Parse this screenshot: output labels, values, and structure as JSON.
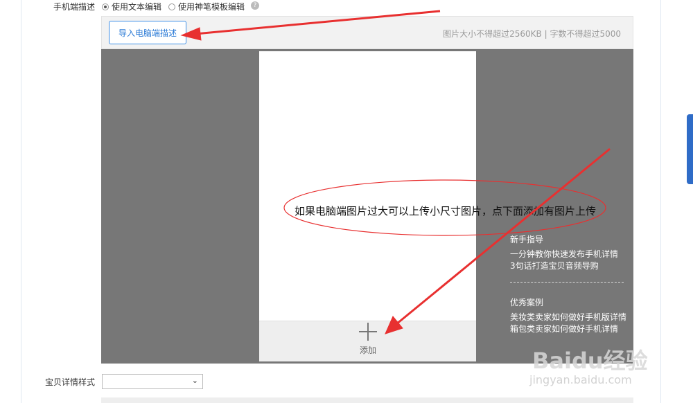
{
  "form": {
    "mobile_desc_label": "手机端描述",
    "radio_text_edit": "使用文本编辑",
    "radio_template_edit": "使用神笔模板编辑",
    "help_icon": "?"
  },
  "toolbar": {
    "import_button": "导入电脑端描述",
    "limit_text": "图片大小不得超过2560KB | 字数不得超过5000"
  },
  "editor": {
    "add_label": "添加",
    "annotation": "如果电脑端图片过大可以上传小尺寸图片，点下面添加有图片上传"
  },
  "guide": {
    "newbie_title": "新手指导",
    "newbie_links": [
      "一分钟教你快速发布手机详情",
      "3句话打造宝贝音频导购"
    ],
    "cases_title": "优秀案例",
    "cases_links": [
      "美妆类卖家如何做好手机版详情",
      "箱包类卖家如何做好手机详情"
    ]
  },
  "detail": {
    "style_label": "宝贝详情样式",
    "style_value": ""
  },
  "watermark": {
    "brand": "Baidu经验",
    "url": "jingyan.baidu.com"
  },
  "colors": {
    "accent": "#2a7ad6",
    "arrow": "#e83030",
    "editor_bg": "#777777"
  }
}
